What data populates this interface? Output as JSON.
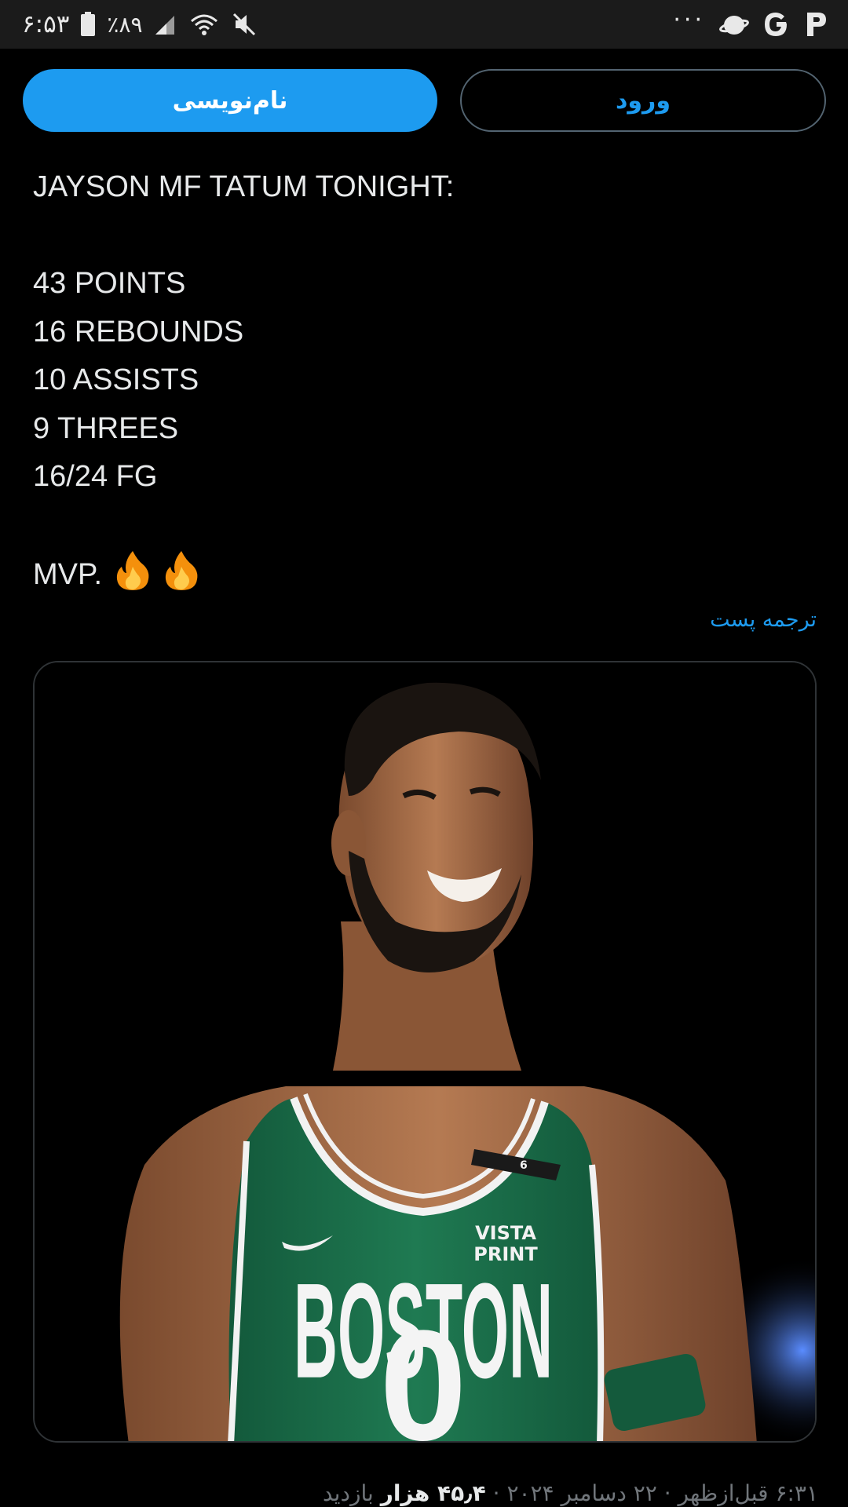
{
  "status_bar": {
    "time": "۶:۵۳",
    "battery_percent": "٪۸۹",
    "icons": [
      "battery-icon",
      "signal-icon",
      "wifi-icon",
      "mute-icon",
      "more-dots-icon",
      "planet-app-icon",
      "google-icon",
      "p-app-icon"
    ],
    "more": "···"
  },
  "auth": {
    "signup_label": "نام‌نویسی",
    "login_label": "ورود"
  },
  "tweet": {
    "lines": [
      "JAYSON MF TATUM TONIGHT:",
      "",
      "43 POINTS",
      "16 REBOUNDS",
      "10 ASSISTS",
      "9 THREES",
      "16/24 FG",
      "",
      "MVP."
    ],
    "emoji": [
      "fire-emoji",
      "fire-emoji"
    ],
    "translate_label": "ترجمه پست",
    "image": {
      "jersey_text": "BOSTON",
      "jersey_number": "0",
      "sponsor": "VISTA PRINT",
      "armband_number": "6"
    },
    "meta": {
      "time_date": "۶:۳۱ قبل‌ازظهر · ۲۲ دسامبر ۲۰۲۴ · ",
      "views_count": "۴۵٫۴ هزار",
      "views_label": " بازدید"
    }
  },
  "colors": {
    "accent": "#1d9bf0",
    "background": "#000000",
    "text": "#e7e9ea",
    "muted": "#71767b",
    "jersey_green": "#1f7a52"
  }
}
